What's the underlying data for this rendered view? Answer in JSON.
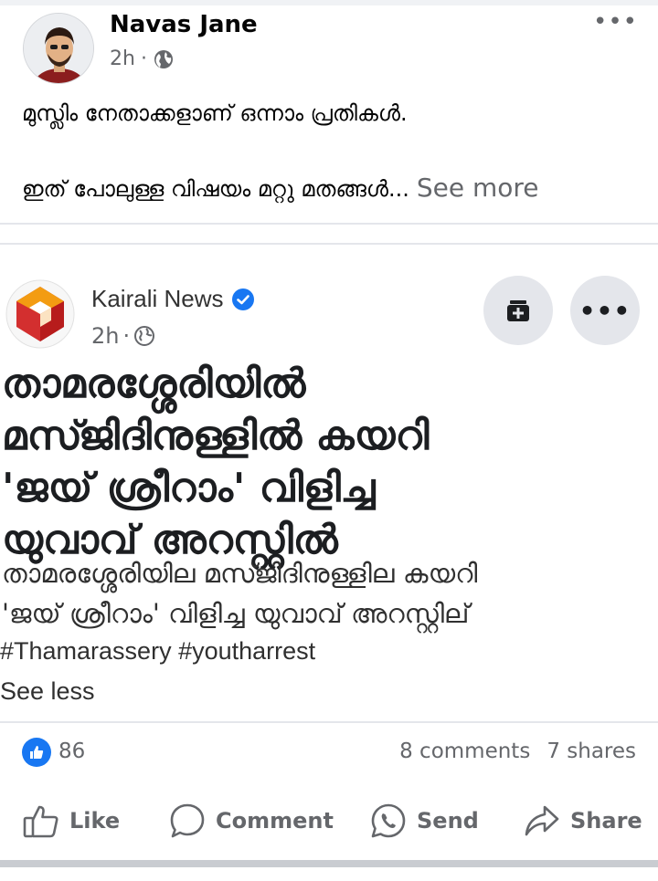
{
  "post": {
    "author": "Navas Jane",
    "time": "2h",
    "separator": "·",
    "text_line1": "മുസ്ലിം നേതാക്കളാണ് ഒന്നാം പ്രതികൾ.",
    "text_line2": "ഇത് പോലുള്ള വിഷയം മറ്റു മതങ്ങൾ...",
    "see_more": "See more",
    "more_glyph": "•••"
  },
  "shared": {
    "page_name": "Kairali News",
    "time": "2h",
    "separator": "·",
    "headline": [
      "താമരശ്ശേരിയിൽ",
      "മസ്ജിദിനുള്ളിൽ കയറി",
      "'ജയ് ശ്രീറാം' വിളിച്ച",
      "യുവാവ് അറസ്റ്റിൽ"
    ],
    "subhead": [
      "താമരശ്ശേരിയില മസ്ജിദിനുള്ളില കയറി",
      "'ജയ് ശ്രീറാം' വിളിച്ച യുവാവ് അറസ്റ്റില്"
    ],
    "hashtags": "#Thamarassery #youtharrest",
    "see_less": "See less",
    "more_glyph": "•••"
  },
  "reactions": {
    "like_count": "86",
    "comments": "8 comments",
    "shares": "7 shares"
  },
  "actions": {
    "like": "Like",
    "comment": "Comment",
    "send": "Send",
    "share": "Share"
  },
  "colors": {
    "facebook_blue": "#1877f2",
    "secondary_text": "#65676b",
    "kairali_red": "#d32f2f",
    "kairali_orange": "#f39c12"
  }
}
